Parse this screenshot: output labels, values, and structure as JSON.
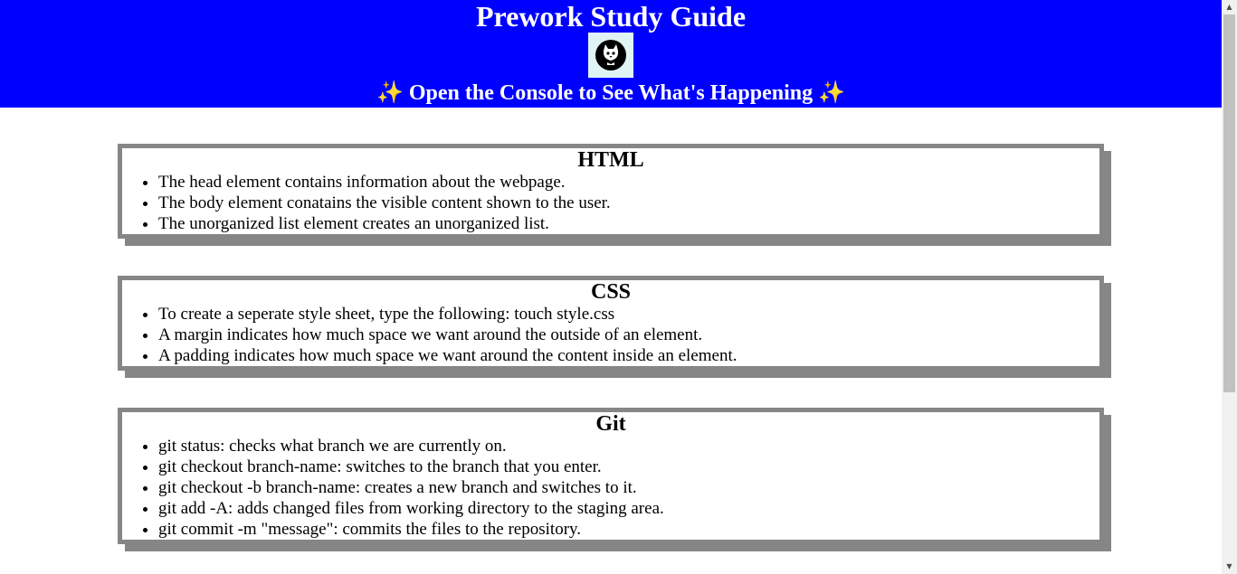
{
  "header": {
    "title": "Prework Study Guide",
    "subtitle": "✨ Open the Console to See What's Happening ✨"
  },
  "sections": [
    {
      "title": "HTML",
      "items": [
        "The head element contains information about the webpage.",
        "The body element conatains the visible content shown to the user.",
        "The unorganized list element creates an unorganized list."
      ]
    },
    {
      "title": "CSS",
      "items": [
        "To create a seperate style sheet, type the following: touch style.css",
        "A margin indicates how much space we want around the outside of an element.",
        "A padding indicates how much space we want around the content inside an element."
      ]
    },
    {
      "title": "Git",
      "items": [
        "git status: checks what branch we are currently on.",
        "git checkout branch-name: switches to the branch that you enter.",
        "git checkout -b branch-name: creates a new branch and switches to it.",
        "git add -A: adds changed files from working directory to the staging area.",
        "git commit -m \"message\": commits the files to the repository."
      ]
    }
  ],
  "colors": {
    "header_bg": "#0000ff",
    "card_border": "#868686"
  },
  "icons": {
    "logo": "cat-avatar-icon"
  }
}
